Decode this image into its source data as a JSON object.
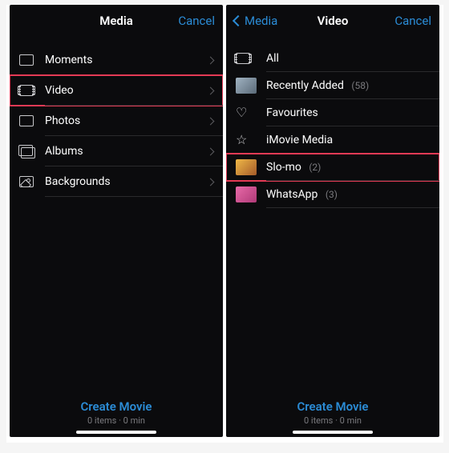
{
  "left": {
    "title": "Media",
    "cancel": "Cancel",
    "rows": [
      {
        "label": "Moments"
      },
      {
        "label": "Video"
      },
      {
        "label": "Photos"
      },
      {
        "label": "Albums"
      },
      {
        "label": "Backgrounds"
      }
    ],
    "create": "Create Movie",
    "meta": "0 items · 0 min"
  },
  "right": {
    "back": "Media",
    "title": "Video",
    "cancel": "Cancel",
    "rows": [
      {
        "label": "All"
      },
      {
        "label": "Recently Added",
        "count": "(58)"
      },
      {
        "label": "Favourites"
      },
      {
        "label": "iMovie Media"
      },
      {
        "label": "Slo-mo",
        "count": "(2)"
      },
      {
        "label": "WhatsApp",
        "count": "(3)"
      }
    ],
    "create": "Create Movie",
    "meta": "0 items · 0 min"
  }
}
